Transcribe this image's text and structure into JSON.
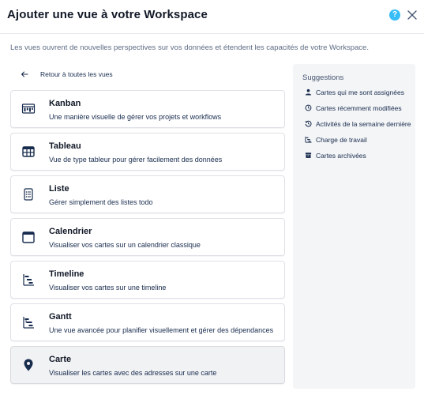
{
  "header": {
    "title": "Ajouter une vue à votre Workspace",
    "help_glyph": "?",
    "help_icon": "help-circle-icon",
    "close_icon": "close-icon"
  },
  "intro": "Les vues ouvrent de nouvelles perspectives sur vos données et étendent les capacités de votre Workspace.",
  "back": {
    "label": "Retour à toutes les vues",
    "icon": "arrow-left-icon"
  },
  "views": [
    {
      "title": "Kanban",
      "description": "Une manière visuelle de gérer vos projets et workflows",
      "icon": "kanban-board-icon"
    },
    {
      "title": "Tableau",
      "description": "Vue de type tableur pour gérer facilement des données",
      "icon": "table-grid-icon"
    },
    {
      "title": "Liste",
      "description": "Gérer simplement des listes todo",
      "icon": "checklist-icon"
    },
    {
      "title": "Calendrier",
      "description": "Visualiser vos cartes sur un calendrier classique",
      "icon": "calendar-icon"
    },
    {
      "title": "Timeline",
      "description": "Visualiser vos cartes sur une timeline",
      "icon": "timeline-icon"
    },
    {
      "title": "Gantt",
      "description": "Une vue avancée pour planifier visuellement et gérer des dépendances",
      "icon": "gantt-icon"
    },
    {
      "title": "Carte",
      "description": "Visualiser les cartes avec des adresses sur une carte",
      "icon": "map-pin-icon",
      "selected": true
    }
  ],
  "suggestions": {
    "heading": "Suggestions",
    "items": [
      {
        "label": "Cartes qui me sont assignées",
        "icon": "user-icon"
      },
      {
        "label": "Cartes récemment modifiées",
        "icon": "clock-icon"
      },
      {
        "label": "Activités de la semaine dernière",
        "icon": "history-icon"
      },
      {
        "label": "Charge de travail",
        "icon": "workload-icon"
      },
      {
        "label": "Cartes archivées",
        "icon": "archive-icon"
      }
    ]
  },
  "colors": {
    "accent": "#38bdf8",
    "selected_bg": "#f1f2f4",
    "panel_bg": "#f4f5f7",
    "text": "#172b4d"
  }
}
